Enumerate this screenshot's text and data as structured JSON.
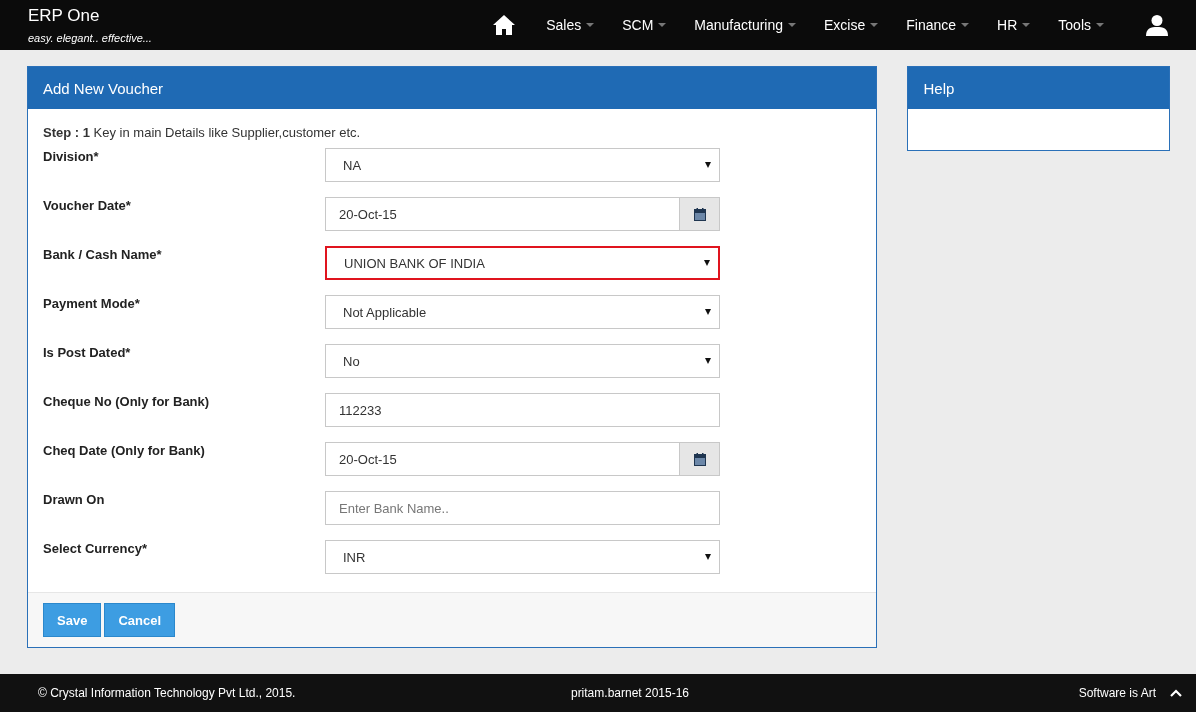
{
  "brand": {
    "name": "ERP One",
    "tagline": "easy. elegant.. effective..."
  },
  "nav": [
    {
      "label": "Sales"
    },
    {
      "label": "SCM"
    },
    {
      "label": "Manufacturing"
    },
    {
      "label": "Excise"
    },
    {
      "label": "Finance"
    },
    {
      "label": "HR"
    },
    {
      "label": "Tools"
    }
  ],
  "panel": {
    "title": "Add New Voucher",
    "step_label": "Step : 1",
    "step_text": "Key in main Details like Supplier,customer etc."
  },
  "fields": [
    {
      "label": "Division*",
      "kind": "select",
      "value": "NA",
      "highlighted": false
    },
    {
      "label": "Voucher Date*",
      "kind": "date",
      "value": "20-Oct-15",
      "highlighted": false
    },
    {
      "label": "Bank / Cash Name*",
      "kind": "select",
      "value": "UNION BANK OF INDIA",
      "highlighted": true
    },
    {
      "label": "Payment Mode*",
      "kind": "select",
      "value": "Not Applicable",
      "highlighted": false
    },
    {
      "label": "Is Post Dated*",
      "kind": "select",
      "value": "No",
      "highlighted": false
    },
    {
      "label": "Cheque No (Only for Bank)",
      "kind": "text",
      "value": "112233",
      "highlighted": false
    },
    {
      "label": "Cheq Date (Only for Bank)",
      "kind": "date",
      "value": "20-Oct-15",
      "highlighted": false
    },
    {
      "label": "Drawn On",
      "kind": "text",
      "placeholder": "Enter Bank Name..",
      "highlighted": false
    },
    {
      "label": "Select Currency*",
      "kind": "select",
      "value": "INR",
      "highlighted": false
    }
  ],
  "buttons": [
    "Save",
    "Cancel"
  ],
  "help": {
    "title": "Help"
  },
  "footer": {
    "copyright": "© Crystal Information Technology Pvt Ltd., 2015.",
    "user": "pritam.barnet 2015-16",
    "slogan": "Software is Art"
  }
}
